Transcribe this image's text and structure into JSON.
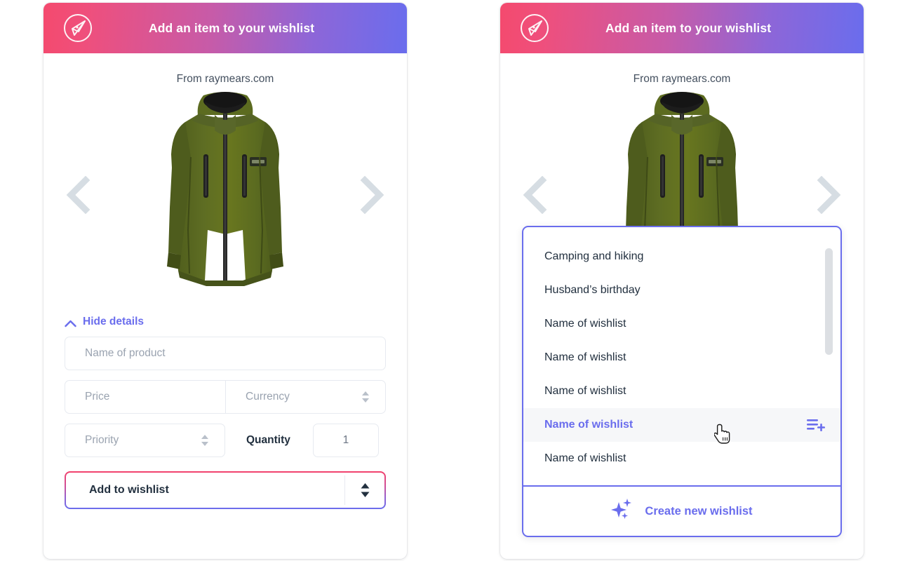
{
  "header": {
    "title": "Add an item to your wishlist",
    "logo_icon": "compass-leaf-logo-icon",
    "gradient_from": "#f4476e",
    "gradient_to": "#6a6ded"
  },
  "source": {
    "label": "From raymears.com"
  },
  "carousel": {
    "prev_icon": "chevron-left-icon",
    "next_icon": "chevron-right-icon",
    "product_image_alt": "Olive green hooded fleece jacket",
    "colors": {
      "fabric": "#5c6b20",
      "fabric_dark": "#4a5718",
      "hood_lining": "#1b1b1b",
      "zipper": "#2b2b2b"
    }
  },
  "details": {
    "toggle_label": "Hide details",
    "toggle_icon": "chevron-up-icon",
    "accent": "#6a6ded"
  },
  "form": {
    "product_name_placeholder": "Name of product",
    "price_placeholder": "Price",
    "currency_placeholder": "Currency",
    "currency_stepper_icon": "stepper-updown-icon",
    "priority_placeholder": "Priority",
    "priority_stepper_icon": "stepper-updown-icon",
    "quantity_label": "Quantity",
    "quantity_value": "1"
  },
  "add_to_wishlist": {
    "label": "Add to wishlist",
    "stepper_icon": "stepper-updown-icon",
    "border_from": "#f2416c",
    "border_to": "#6a6ded"
  },
  "dropdown": {
    "border_color": "#6a6ded",
    "items": [
      {
        "label": "Camping and hiking",
        "active": false
      },
      {
        "label": "Husband’s birthday",
        "active": false
      },
      {
        "label": "Name of wishlist",
        "active": false
      },
      {
        "label": "Name of wishlist",
        "active": false
      },
      {
        "label": "Name of wishlist",
        "active": false
      },
      {
        "label": "Name of wishlist",
        "active": true
      },
      {
        "label": "Name of wishlist",
        "active": false
      }
    ],
    "active_item_icon": "playlist-add-icon",
    "scrollbar": true,
    "create": {
      "label": "Create new wishlist",
      "icon": "sparkles-icon"
    }
  },
  "cursor": {
    "icon": "pointer-hand-cursor"
  }
}
